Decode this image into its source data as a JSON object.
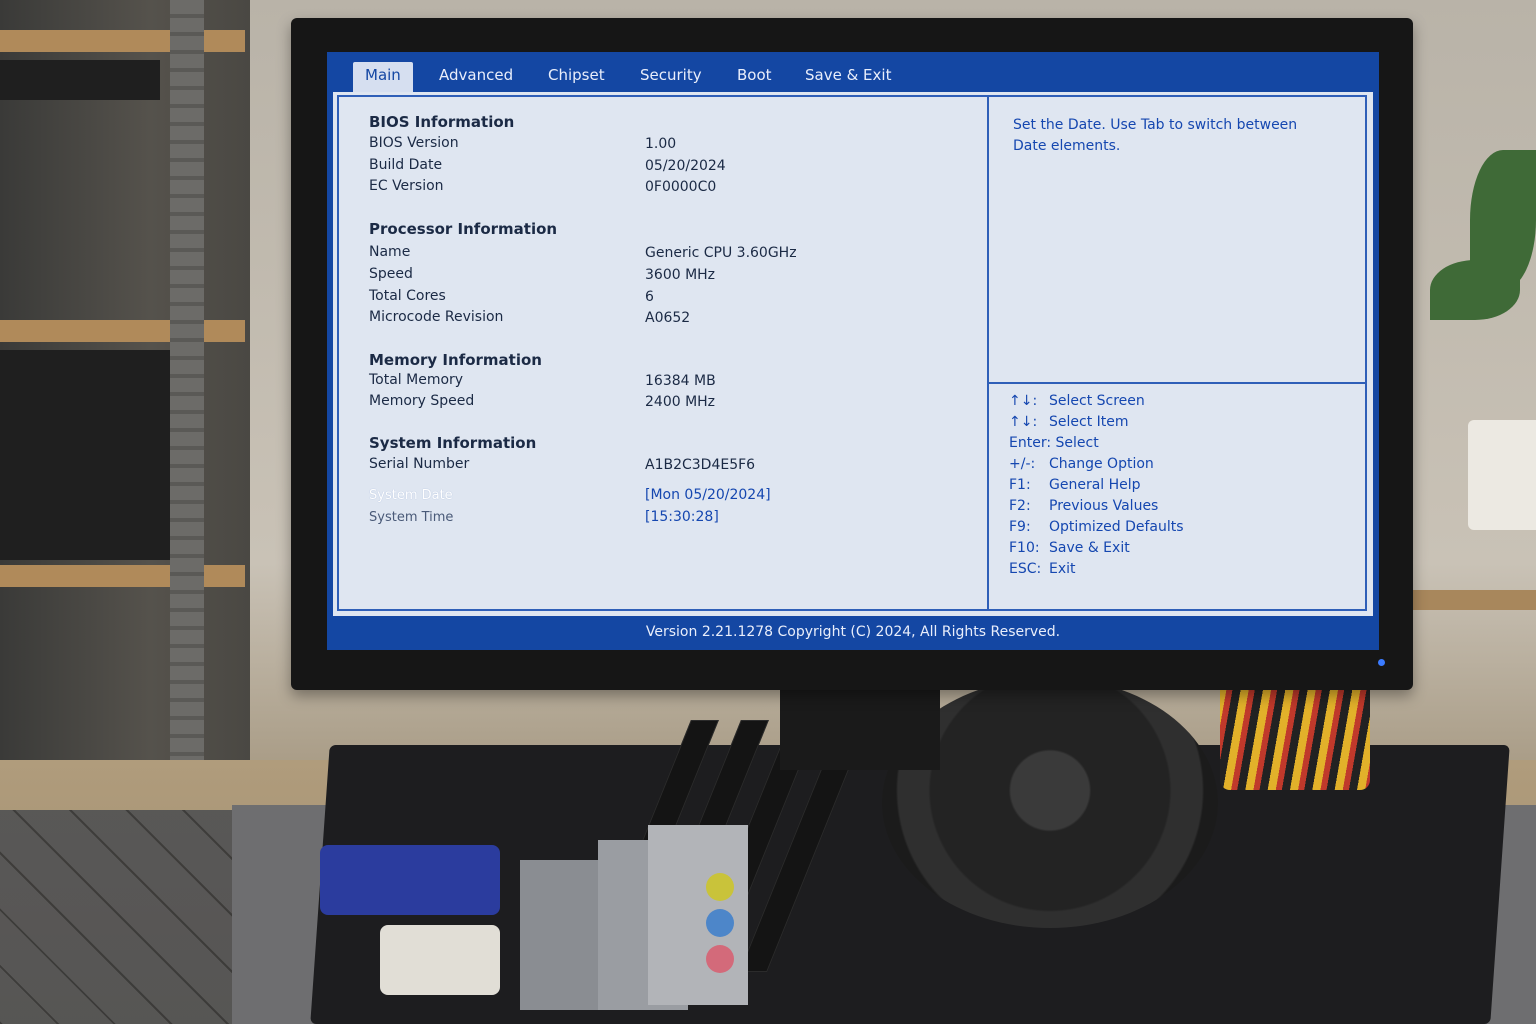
{
  "tabs": [
    {
      "label": "Main"
    },
    {
      "label": "Advanced"
    },
    {
      "label": "Chipset"
    },
    {
      "label": "Security"
    },
    {
      "label": "Boot"
    },
    {
      "label": "Save & Exit"
    }
  ],
  "bios_info": {
    "title": "BIOS Information",
    "rows": [
      {
        "label": "BIOS Version",
        "value": "1.00"
      },
      {
        "label": "Build Date",
        "value": "05/20/2024"
      },
      {
        "label": "EC Version",
        "value": "0F0000C0"
      }
    ]
  },
  "processor_info": {
    "title": "Processor Information",
    "rows": [
      {
        "label": "Name",
        "value": "Generic CPU 3.60GHz"
      },
      {
        "label": "Speed",
        "value": "3600 MHz"
      },
      {
        "label": "Total Cores",
        "value": "6"
      },
      {
        "label": "Microcode Revision",
        "value": "A0652"
      }
    ]
  },
  "memory_info": {
    "title": "Memory Information",
    "rows": [
      {
        "label": "Total Memory",
        "value": "16384 MB"
      },
      {
        "label": "Memory Speed",
        "value": "2400 MHz"
      }
    ]
  },
  "system_info": {
    "title": "System Information",
    "serial": {
      "label": "Serial Number",
      "value": "A1B2C3D4E5F6"
    },
    "date": {
      "label": "System Date",
      "value": "[Mon 05/20/2024]"
    },
    "time": {
      "label": "System Time",
      "value": "[15:30:28]"
    }
  },
  "help": {
    "text": "Set the Date. Use Tab to switch between Date elements.",
    "keys": [
      {
        "key": "↑↓:",
        "action": "Select Screen"
      },
      {
        "key": "↑↓:",
        "action": "Select Item"
      },
      {
        "key": "Enter:",
        "action": "Select"
      },
      {
        "key": "+/-:",
        "action": "Change Option"
      },
      {
        "key": "F1:",
        "action": "General Help"
      },
      {
        "key": "F2:",
        "action": "Previous Values"
      },
      {
        "key": "F9:",
        "action": "Optimized Defaults"
      },
      {
        "key": "F10:",
        "action": "Save & Exit"
      },
      {
        "key": "ESC:",
        "action": "Exit"
      }
    ]
  },
  "footer": {
    "text": "Version 2.21.1278 Copyright (C) 2024, All Rights Reserved."
  },
  "colors": {
    "bios_blue": "#1447a3",
    "panel_bg": "#dfe6f1",
    "highlight_text": "#1547b0"
  }
}
